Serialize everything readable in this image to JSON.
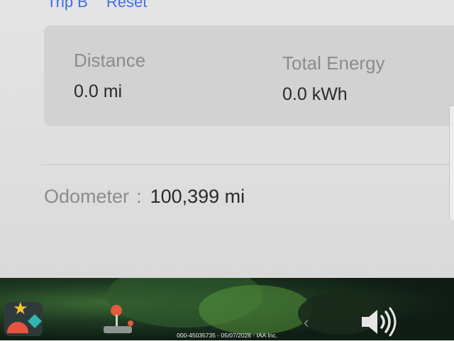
{
  "trip": {
    "tab_label": "Trip B",
    "reset_label": "Reset",
    "distance_label": "Distance",
    "distance_value": "0.0 mi",
    "energy_label": "Total Energy",
    "energy_value": "0.0 kWh"
  },
  "odometer": {
    "label": "Odometer",
    "separator": ":",
    "value": "100,399 mi"
  },
  "taskbar": {
    "apps": [
      "toybox-icon",
      "arcade-icon"
    ],
    "nav_back_glyph": "‹",
    "volume_icon": "volume-icon"
  },
  "watermark": "000-45035735 - 05/07/2026 - IAA Inc.",
  "colors": {
    "link": "#3f6ee8",
    "label": "#8c8c8c",
    "value": "#2a2a2a",
    "card": "#d2d2d2"
  }
}
